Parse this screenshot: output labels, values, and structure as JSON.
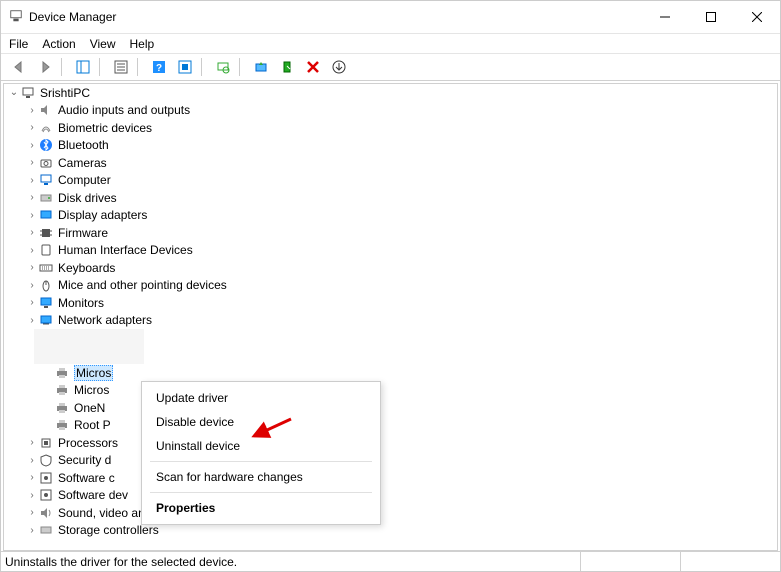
{
  "window": {
    "title": "Device Manager"
  },
  "menu": {
    "file": "File",
    "action": "Action",
    "view": "View",
    "help": "Help"
  },
  "tree": {
    "root": "SrishtiPC",
    "cats": [
      "Audio inputs and outputs",
      "Biometric devices",
      "Bluetooth",
      "Cameras",
      "Computer",
      "Disk drives",
      "Display adapters",
      "Firmware",
      "Human Interface Devices",
      "Keyboards",
      "Mice and other pointing devices",
      "Monitors",
      "Network adapters"
    ],
    "printers": {
      "sel": "Micros",
      "p2": "Micros",
      "p3": "OneN",
      "p4": "Root P"
    },
    "cats2": [
      "Processors",
      "Security d",
      "Software c",
      "Software dev",
      "Sound, video and game controllers",
      "Storage controllers"
    ]
  },
  "ctx": {
    "update": "Update driver",
    "disable": "Disable device",
    "uninstall": "Uninstall device",
    "scan": "Scan for hardware changes",
    "props": "Properties"
  },
  "status": "Uninstalls the driver for the selected device."
}
